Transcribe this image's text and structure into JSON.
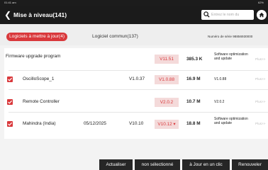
{
  "status": {
    "time": "01:41 am",
    "battery": "62%"
  },
  "header": {
    "title": "Mise à niveau(141)",
    "search_placeholder": "Entrez le nom du"
  },
  "tabs": {
    "active": "Logiciels à mettre à jour(4)",
    "common": "Logiciel commun(137)",
    "serial": "Numéro de série  98856930000"
  },
  "rows": [
    {
      "name": "Firmware upgrade program",
      "date": "",
      "current": "",
      "new": "V11.51",
      "size": "385.3 K",
      "desc": "Software optimization and update",
      "more": "Plus>>"
    },
    {
      "name": "OscilloScope_1",
      "date": "",
      "current": "V1.0.37",
      "new": "V1.0.88",
      "size": "16.9 M",
      "desc": "V1.0.88",
      "more": "Plus>>"
    },
    {
      "name": "Remote Controller",
      "date": "",
      "current": "",
      "new": "V2.0.2",
      "size": "10.7 M",
      "desc": "V2.0.2",
      "more": "Plus>>"
    },
    {
      "name": "Mahindra (India)",
      "date": "05/12/2025",
      "current": "V10.10",
      "new": "V10.12 ▾",
      "size": "18.8 M",
      "desc": "Software optimization and update",
      "more": "Plus>>"
    }
  ],
  "buttons": {
    "update": "Actualiser",
    "unselected": "non sélectionné",
    "one_click": "à Jour en un clic",
    "renew": "Renouveler"
  },
  "colors": {
    "accent": "#d9383b",
    "header": "#1b1b1b"
  }
}
